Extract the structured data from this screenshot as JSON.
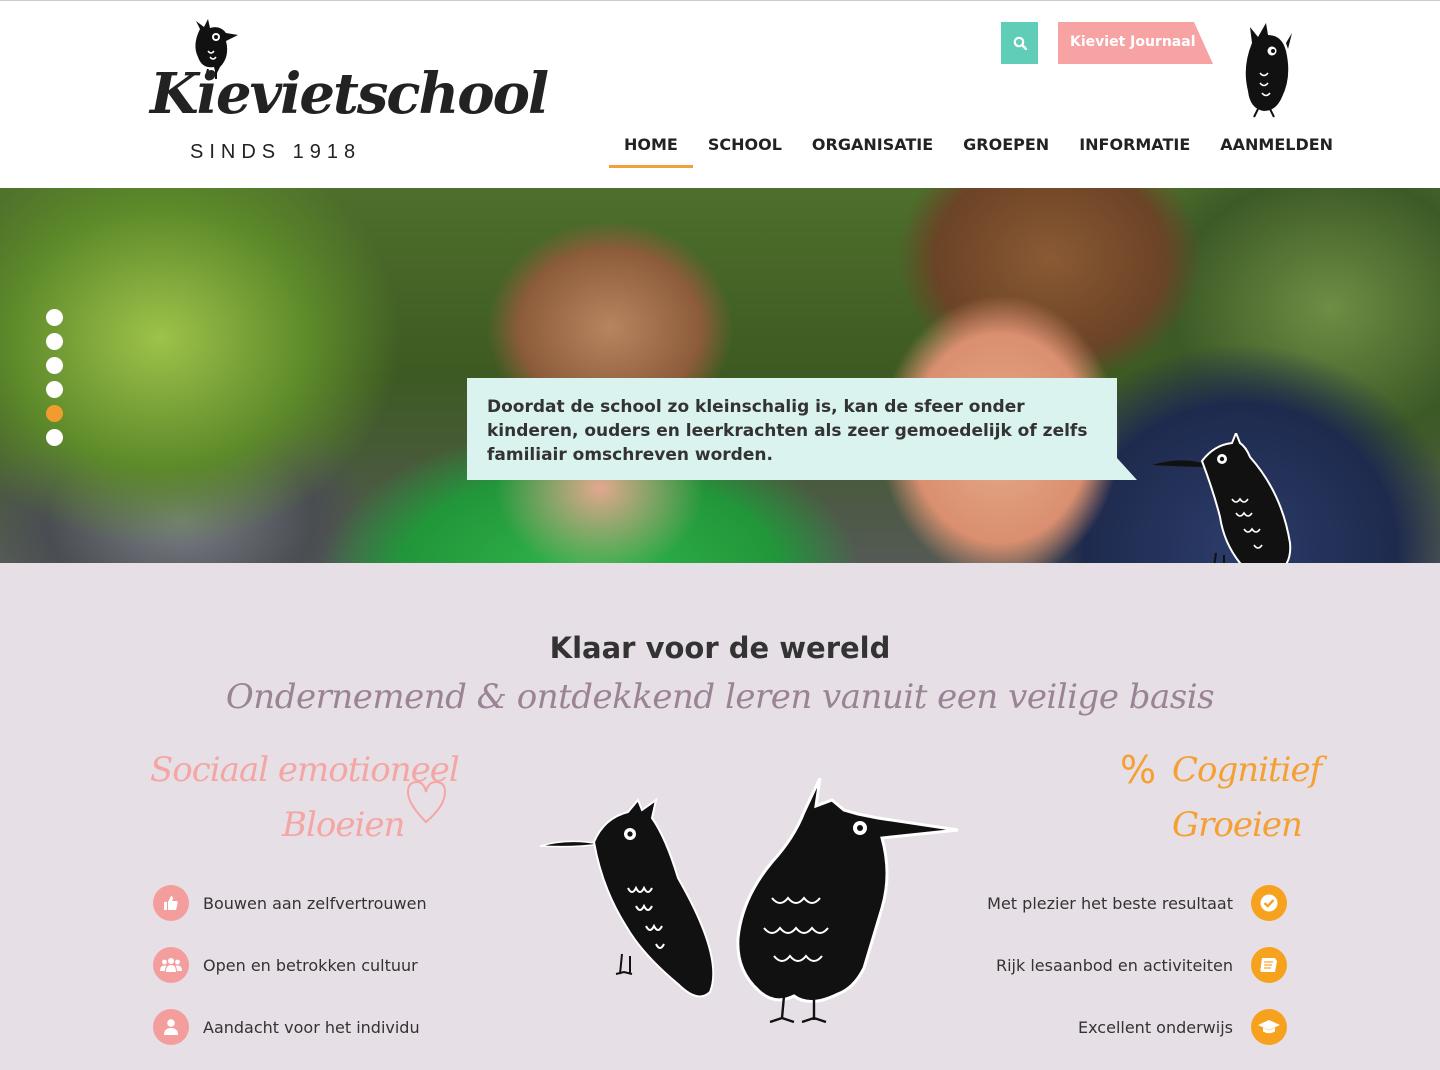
{
  "header": {
    "logo_text": "Kievietschool",
    "logo_subtitle": "SINDS 1918",
    "journaal_label": "Kieviet Journaal"
  },
  "nav": {
    "items": [
      {
        "label": "HOME",
        "active": true
      },
      {
        "label": "SCHOOL",
        "active": false
      },
      {
        "label": "ORGANISATIE",
        "active": false
      },
      {
        "label": "GROEPEN",
        "active": false
      },
      {
        "label": "INFORMATIE",
        "active": false
      },
      {
        "label": "AANMELDEN",
        "active": false
      }
    ]
  },
  "hero": {
    "slide_count": 6,
    "active_slide": 5,
    "quote": "Doordat de school zo kleinschalig is, kan de sfeer onder kinderen, ouders en leerkrachten als zeer gemoedelijk of zelfs familiair omschreven worden."
  },
  "section": {
    "title": "Klaar voor de wereld",
    "subtitle": "Ondernemend & ontdekkend leren vanuit een veilige basis",
    "left": {
      "heading_1": "Sociaal emotioneel",
      "heading_2": "Bloeien",
      "features": [
        {
          "label": "Bouwen aan zelfvertrouwen",
          "icon": "thumbs-up-icon"
        },
        {
          "label": "Open en betrokken cultuur",
          "icon": "group-icon"
        },
        {
          "label": "Aandacht voor het individu",
          "icon": "user-icon"
        }
      ]
    },
    "right": {
      "symbol": "%",
      "heading_1": "Cognitief",
      "heading_2": "Groeien",
      "features": [
        {
          "label": "Met plezier het beste resultaat",
          "icon": "check-icon"
        },
        {
          "label": "Rijk lesaanbod en activiteiten",
          "icon": "book-icon"
        },
        {
          "label": "Excellent onderwijs",
          "icon": "graduation-cap-icon"
        }
      ]
    }
  },
  "colors": {
    "accent_orange": "#f29b2e",
    "teal": "#5fcdb8",
    "pink": "#f4a6a4",
    "section_bg": "#e6dfe5",
    "quote_bg": "#daf3ee"
  }
}
